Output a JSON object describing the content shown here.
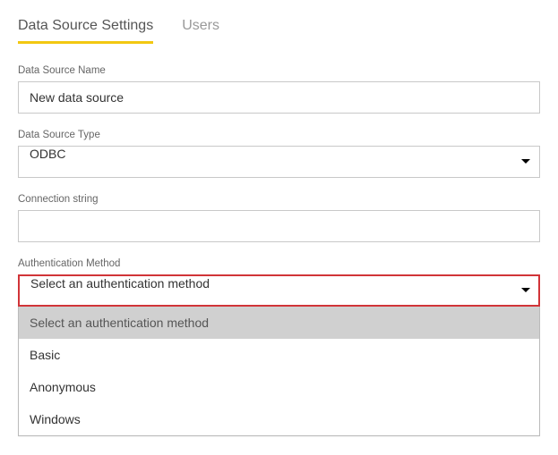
{
  "tabs": {
    "settings": "Data Source Settings",
    "users": "Users"
  },
  "fields": {
    "name_label": "Data Source Name",
    "name_value": "New data source",
    "type_label": "Data Source Type",
    "type_value": "ODBC",
    "connstr_label": "Connection string",
    "connstr_value": "",
    "auth_label": "Authentication Method",
    "auth_value": "Select an authentication method"
  },
  "auth_options": {
    "placeholder": "Select an authentication method",
    "basic": "Basic",
    "anonymous": "Anonymous",
    "windows": "Windows"
  }
}
